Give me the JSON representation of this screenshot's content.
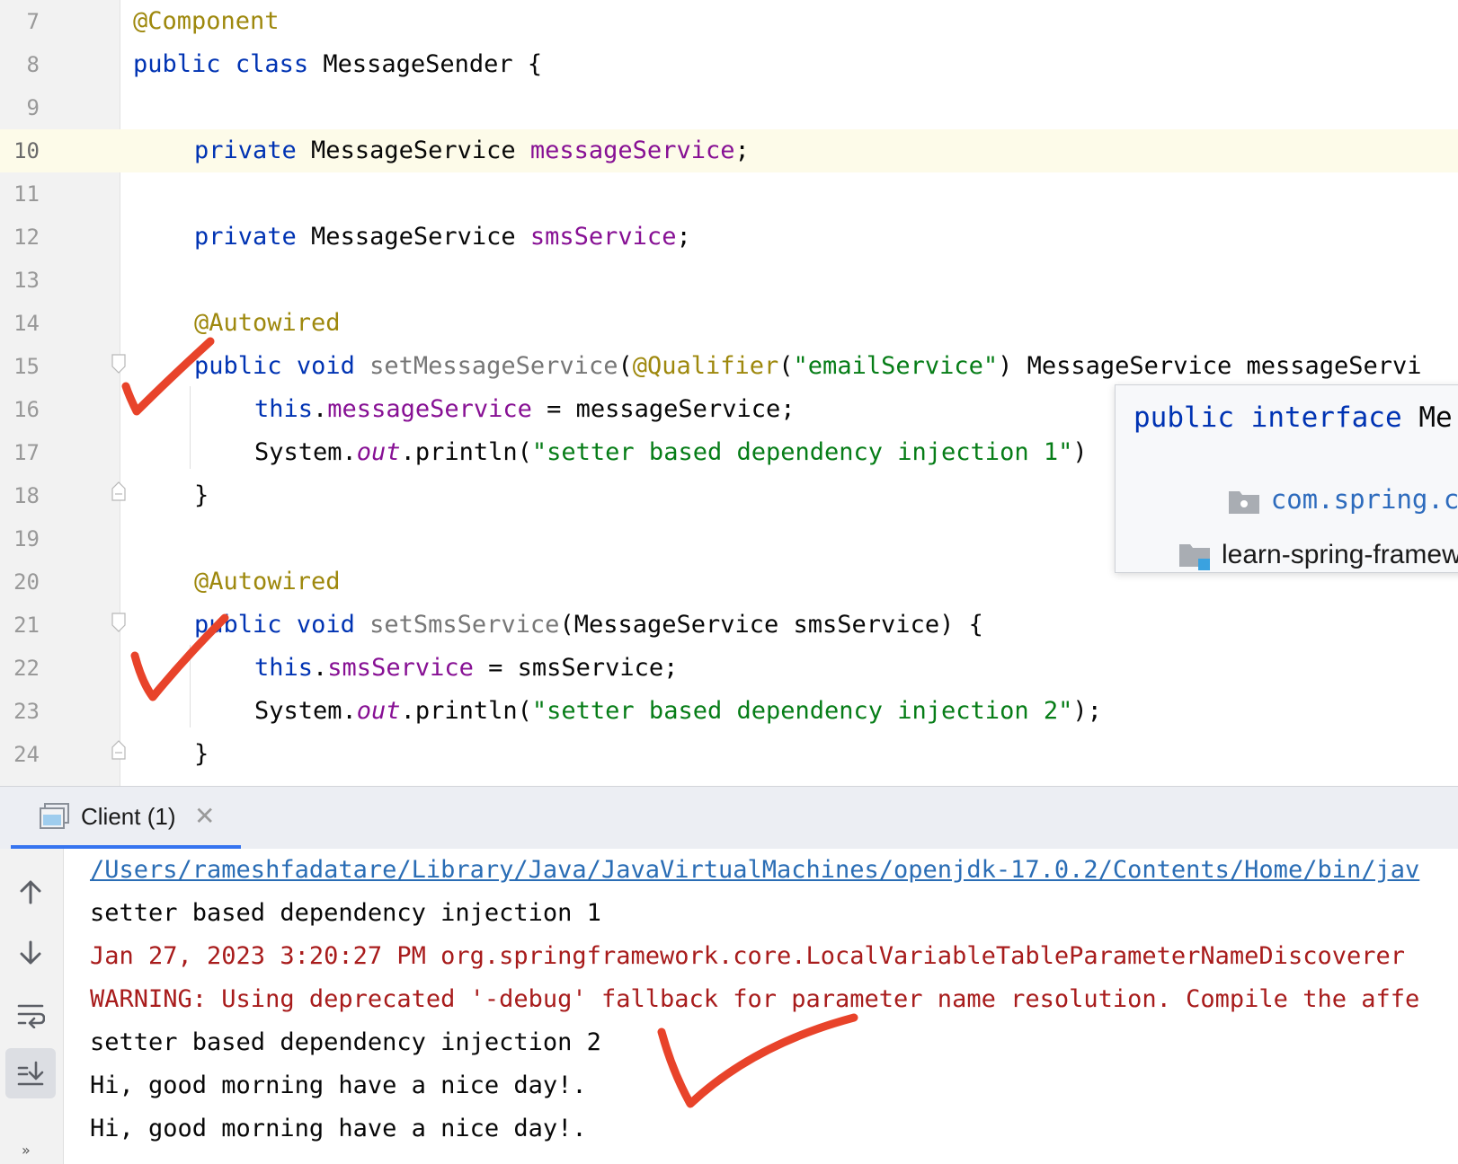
{
  "editor": {
    "lines": [
      {
        "num": "7"
      },
      {
        "num": "8"
      },
      {
        "num": "9"
      },
      {
        "num": "10"
      },
      {
        "num": "11"
      },
      {
        "num": "12"
      },
      {
        "num": "13"
      },
      {
        "num": "14"
      },
      {
        "num": "15"
      },
      {
        "num": "16"
      },
      {
        "num": "17"
      },
      {
        "num": "18"
      },
      {
        "num": "19"
      },
      {
        "num": "20"
      },
      {
        "num": "21"
      },
      {
        "num": "22"
      },
      {
        "num": "23"
      },
      {
        "num": "24"
      }
    ],
    "tokens": {
      "component_ann": "@Component",
      "public": "public",
      "class": "class",
      "class_name": " MessageSender {",
      "private": "private",
      "message_service_type": " MessageService ",
      "message_service_field": "messageService",
      "semicolon": ";",
      "sms_service_field": "smsService",
      "autowired": "@Autowired",
      "void": "void",
      "set_message_service": "setMessageService",
      "open_paren": "(",
      "qualifier": "@Qualifier",
      "qualifier_arg": "\"emailService\"",
      "param1_rest": ") MessageService messageServi",
      "this": "this",
      "dot": ".",
      "assign_message": " = messageService;",
      "system": "System.",
      "out": "out",
      "println": ".println(",
      "string1": "\"setter based dependency injection 1\"",
      "close_paren1": ")",
      "close_brace": "}",
      "set_sms_service": "setSmsService",
      "param2": "(MessageService smsService) {",
      "assign_sms": " = smsService;",
      "string2": "\"setter based dependency injection 2\"",
      "close_call": ");"
    }
  },
  "popup": {
    "public": "public",
    "interface": "interface",
    "name": "Me",
    "package": "com.spring.core.c",
    "module": "learn-spring-framew"
  },
  "run_panel": {
    "tab_label": "Client (1)",
    "close_glyph": "✕",
    "more_glyph": "»"
  },
  "console": {
    "lines": [
      {
        "text": "/Users/rameshfadatare/Library/Java/JavaVirtualMachines/openjdk-17.0.2/Contents/Home/bin/jav",
        "kind": "link"
      },
      {
        "text": "setter based dependency injection 1",
        "kind": "normal"
      },
      {
        "text": "Jan 27, 2023 3:20:27 PM org.springframework.core.LocalVariableTableParameterNameDiscoverer",
        "kind": "err"
      },
      {
        "text": "WARNING: Using deprecated '-debug' fallback for parameter name resolution. Compile the affe",
        "kind": "err"
      },
      {
        "text": "setter based dependency injection 2",
        "kind": "normal"
      },
      {
        "text": "Hi, good morning have a nice day!.",
        "kind": "normal"
      },
      {
        "text": "Hi, good morning have a nice day!.",
        "kind": "normal"
      }
    ]
  },
  "colors": {
    "keyword": "#0033b3",
    "annotation": "#9e880d",
    "field": "#871094",
    "string": "#067d17",
    "error_text": "#a81c1c",
    "link": "#2a6db5",
    "checkmark": "#e8432a",
    "tab_underline": "#3574f0"
  },
  "icons": [
    "fold-icon",
    "package-icon",
    "module-icon",
    "console-tab-icon",
    "close-icon",
    "scroll-up-icon",
    "scroll-down-icon",
    "soft-wrap-icon",
    "scroll-to-end-icon",
    "more-icon",
    "checkmark-icon"
  ]
}
